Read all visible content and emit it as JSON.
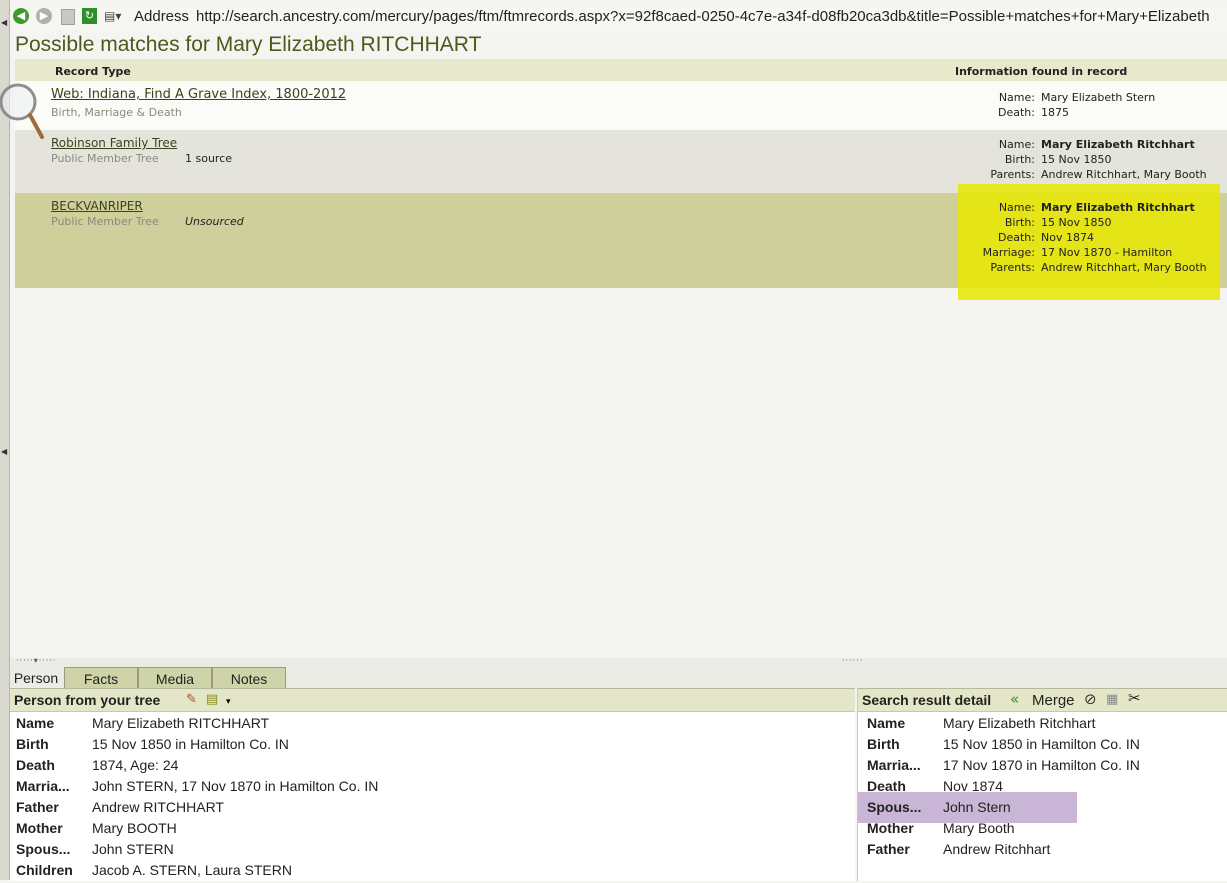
{
  "address_bar": {
    "label": "Address",
    "url": "http://search.ancestry.com/mercury/pages/ftm/ftmrecords.aspx?x=92f8caed-0250-4c7e-a34f-d08fb20ca3db&title=Possible+matches+for+Mary+Elizabeth"
  },
  "page": {
    "title": "Possible matches for Mary Elizabeth RITCHHART",
    "col_record_type": "Record Type",
    "col_info": "Information found in record"
  },
  "records": [
    {
      "title": "Web: Indiana, Find A Grave Index, 1800-2012",
      "subtitle": "Birth, Marriage & Death",
      "source": "",
      "info": [
        {
          "label": "Name:",
          "value": "Mary Elizabeth Stern"
        },
        {
          "label": "Death:",
          "value": "1875"
        }
      ]
    },
    {
      "title": "Robinson Family Tree",
      "subtitle": "Public Member Tree",
      "source": "1 source",
      "info": [
        {
          "label": "Name:",
          "value": "Mary Elizabeth Ritchhart"
        },
        {
          "label": "Birth:",
          "value": "15 Nov 1850"
        },
        {
          "label": "Parents:",
          "value": "Andrew Ritchhart, Mary Booth"
        }
      ]
    },
    {
      "title": "BECKVANRIPER",
      "subtitle": "Public Member Tree",
      "source": "Unsourced",
      "info": [
        {
          "label": "Name:",
          "value": "Mary Elizabeth Ritchhart"
        },
        {
          "label": "Birth:",
          "value": "15 Nov 1850"
        },
        {
          "label": "Death:",
          "value": "Nov 1874"
        },
        {
          "label": "Marriage:",
          "value": "17 Nov 1870 - Hamilton"
        },
        {
          "label": "Parents:",
          "value": "Andrew Ritchhart, Mary Booth"
        }
      ]
    }
  ],
  "tabs": {
    "person": "Person",
    "facts": "Facts",
    "media": "Media",
    "notes": "Notes"
  },
  "person_panel": {
    "title": "Person from your tree",
    "facts": [
      {
        "label": "Name",
        "value": "Mary Elizabeth RITCHHART"
      },
      {
        "label": "Birth",
        "value": "15 Nov 1850 in Hamilton Co. IN"
      },
      {
        "label": "Death",
        "value": "1874, Age: 24"
      },
      {
        "label": "Marria...",
        "value": "John STERN, 17 Nov 1870 in Hamilton Co. IN"
      },
      {
        "label": "Father",
        "value": "Andrew RITCHHART"
      },
      {
        "label": "Mother",
        "value": "Mary BOOTH"
      },
      {
        "label": "Spous...",
        "value": "John STERN"
      },
      {
        "label": "Children",
        "value": "Jacob A. STERN, Laura STERN"
      }
    ]
  },
  "search_panel": {
    "title": "Search result detail",
    "merge_label": "Merge",
    "facts": [
      {
        "label": "Name",
        "value": "Mary Elizabeth Ritchhart"
      },
      {
        "label": "Birth",
        "value": "15 Nov 1850 in Hamilton Co. IN"
      },
      {
        "label": "Marria...",
        "value": "17 Nov 1870 in Hamilton Co. IN"
      },
      {
        "label": "Death",
        "value": "Nov 1874"
      },
      {
        "label": "Spous...",
        "value": "John Stern"
      },
      {
        "label": "Mother",
        "value": "Mary Booth"
      },
      {
        "label": "Father",
        "value": "Andrew Ritchhart"
      }
    ]
  },
  "colors": {
    "title_green": "#4d5a1c",
    "highlight_yellow": "#e8e800",
    "spouse_highlight": "#c9b6d6",
    "selected_row": "#cfcf9c"
  }
}
